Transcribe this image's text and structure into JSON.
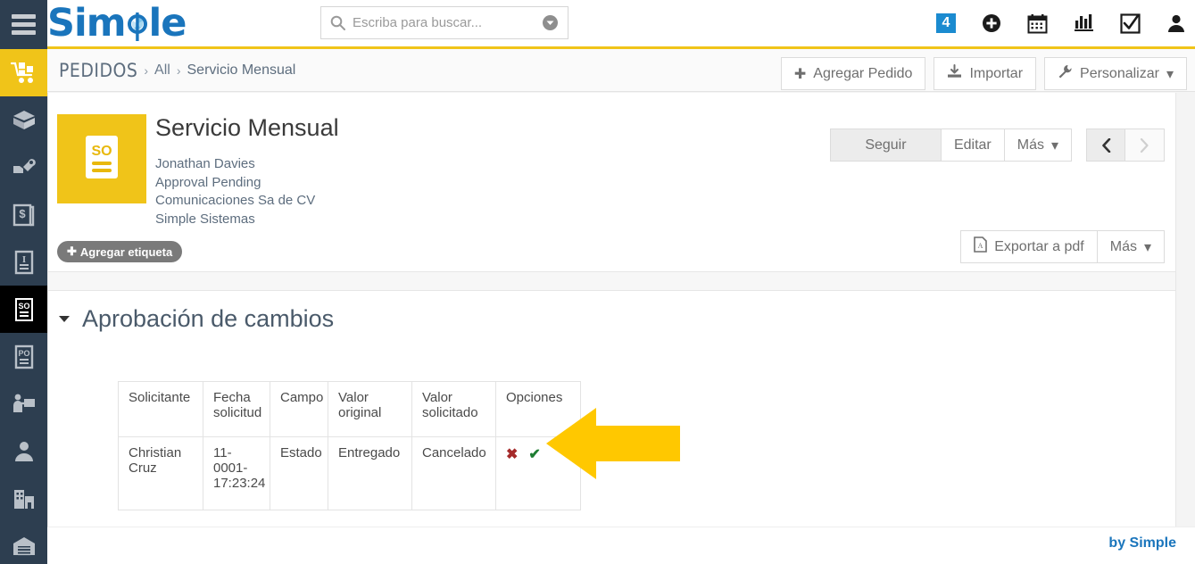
{
  "app": {
    "logo_text": "Simple",
    "footer_credit": "by Simple"
  },
  "sidebar": {
    "menu_icon": "hamburger-icon",
    "items": [
      {
        "name": "orders",
        "icon": "cart-truck-icon",
        "state": "active-yellow"
      },
      {
        "name": "products",
        "icon": "open-box-icon",
        "state": "normal"
      },
      {
        "name": "services",
        "icon": "hand-wrench-icon",
        "state": "normal"
      },
      {
        "name": "price-book",
        "icon": "dollar-book-icon",
        "state": "normal"
      },
      {
        "name": "invoices",
        "icon": "text-document-icon",
        "state": "normal"
      },
      {
        "name": "sales-orders",
        "icon": "so-document-icon",
        "state": "active-dark"
      },
      {
        "name": "purchase-orders",
        "icon": "po-document-icon",
        "state": "normal"
      },
      {
        "name": "leads",
        "icon": "person-presenting-icon",
        "state": "normal"
      },
      {
        "name": "contacts",
        "icon": "person-icon",
        "state": "normal"
      },
      {
        "name": "accounts",
        "icon": "building-icon",
        "state": "normal"
      },
      {
        "name": "warehouse",
        "icon": "warehouse-icon",
        "state": "normal"
      }
    ]
  },
  "search": {
    "placeholder": "Escriba para buscar...",
    "value": "",
    "icon": "search-icon",
    "dropdown_icon": "chevron-down-circle-icon"
  },
  "topbar": {
    "notification_count": "4",
    "icons": [
      {
        "name": "add-icon"
      },
      {
        "name": "calendar-icon"
      },
      {
        "name": "analytics-icon"
      },
      {
        "name": "tasks-checkbox-icon"
      },
      {
        "name": "user-profile-icon"
      }
    ]
  },
  "breadcrumb": {
    "root": "PEDIDOS",
    "separator": "›",
    "middle": "All",
    "leaf": "Servicio Mensual"
  },
  "crumb_actions": {
    "add_label": "Agregar Pedido",
    "add_icon": "plus-icon",
    "import_label": "Importar",
    "import_icon": "import-download-icon",
    "customize_label": "Personalizar",
    "customize_icon": "wrench-icon",
    "customize_caret": "▾"
  },
  "record": {
    "icon_label": "SO",
    "icon_name": "so-document-icon",
    "title": "Servicio Mensual",
    "meta": [
      "Jonathan Davies",
      "Approval Pending",
      "Comunicaciones Sa de CV",
      "Simple Sistemas"
    ],
    "tag_button": "Agregar etiqueta",
    "tag_icon": "plus-icon",
    "actions": {
      "follow": "Seguir",
      "edit": "Editar",
      "more": "Más",
      "more_caret": "▾",
      "prev_icon": "chevron-left-icon",
      "next_icon": "chevron-right-icon"
    },
    "export": {
      "pdf_label": "Exportar a pdf",
      "pdf_icon": "pdf-file-icon",
      "more_label": "Más",
      "more_caret": "▾"
    }
  },
  "section": {
    "title": "Aprobación de cambios",
    "collapse_icon": "caret-down-icon",
    "table": {
      "headers": [
        "Solicitante",
        "Fecha solicitud",
        "Campo",
        "Valor original",
        "Valor solicitado",
        "Opciones"
      ],
      "rows": [
        {
          "solicitante": "Christian Cruz",
          "fecha_solicitud": "11-0001-17:23:24",
          "campo": "Estado",
          "valor_original": "Entregado",
          "valor_solicitado": "Cancelado",
          "reject_icon": "✖",
          "approve_icon": "✔"
        }
      ]
    }
  },
  "annotation": {
    "arrow": "left-pointing-arrow",
    "color": "#ffc800"
  },
  "colors": {
    "sidebar_bg": "#2d3e50",
    "accent_yellow": "#f0c419",
    "brand_blue": "#1a75bc",
    "badge_blue": "#1b8bd0",
    "reject_red": "#a52a2a",
    "approve_green": "#1e7d32"
  }
}
